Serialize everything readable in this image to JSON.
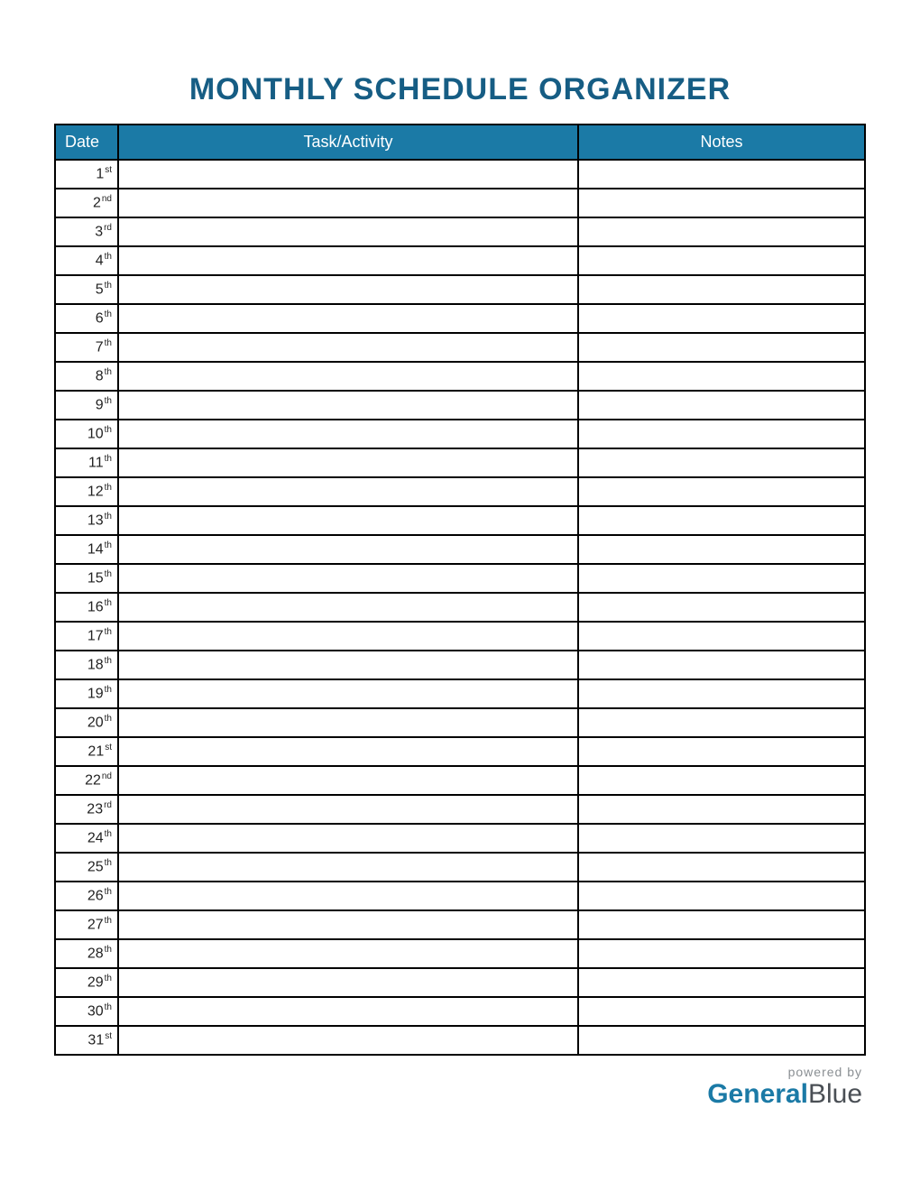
{
  "title": "MONTHLY SCHEDULE ORGANIZER",
  "headers": {
    "date": "Date",
    "task": "Task/Activity",
    "notes": "Notes"
  },
  "rows": [
    {
      "num": "1",
      "suffix": "st",
      "task": "",
      "notes": ""
    },
    {
      "num": "2",
      "suffix": "nd",
      "task": "",
      "notes": ""
    },
    {
      "num": "3",
      "suffix": "rd",
      "task": "",
      "notes": ""
    },
    {
      "num": "4",
      "suffix": "th",
      "task": "",
      "notes": ""
    },
    {
      "num": "5",
      "suffix": "th",
      "task": "",
      "notes": ""
    },
    {
      "num": "6",
      "suffix": "th",
      "task": "",
      "notes": ""
    },
    {
      "num": "7",
      "suffix": "th",
      "task": "",
      "notes": ""
    },
    {
      "num": "8",
      "suffix": "th",
      "task": "",
      "notes": ""
    },
    {
      "num": "9",
      "suffix": "th",
      "task": "",
      "notes": ""
    },
    {
      "num": "10",
      "suffix": "th",
      "task": "",
      "notes": ""
    },
    {
      "num": "11",
      "suffix": "th",
      "task": "",
      "notes": ""
    },
    {
      "num": "12",
      "suffix": "th",
      "task": "",
      "notes": ""
    },
    {
      "num": "13",
      "suffix": "th",
      "task": "",
      "notes": ""
    },
    {
      "num": "14",
      "suffix": "th",
      "task": "",
      "notes": ""
    },
    {
      "num": "15",
      "suffix": "th",
      "task": "",
      "notes": ""
    },
    {
      "num": "16",
      "suffix": "th",
      "task": "",
      "notes": ""
    },
    {
      "num": "17",
      "suffix": "th",
      "task": "",
      "notes": ""
    },
    {
      "num": "18",
      "suffix": "th",
      "task": "",
      "notes": ""
    },
    {
      "num": "19",
      "suffix": "th",
      "task": "",
      "notes": ""
    },
    {
      "num": "20",
      "suffix": "th",
      "task": "",
      "notes": ""
    },
    {
      "num": "21",
      "suffix": "st",
      "task": "",
      "notes": ""
    },
    {
      "num": "22",
      "suffix": "nd",
      "task": "",
      "notes": ""
    },
    {
      "num": "23",
      "suffix": "rd",
      "task": "",
      "notes": ""
    },
    {
      "num": "24",
      "suffix": "th",
      "task": "",
      "notes": ""
    },
    {
      "num": "25",
      "suffix": "th",
      "task": "",
      "notes": ""
    },
    {
      "num": "26",
      "suffix": "th",
      "task": "",
      "notes": ""
    },
    {
      "num": "27",
      "suffix": "th",
      "task": "",
      "notes": ""
    },
    {
      "num": "28",
      "suffix": "th",
      "task": "",
      "notes": ""
    },
    {
      "num": "29",
      "suffix": "th",
      "task": "",
      "notes": ""
    },
    {
      "num": "30",
      "suffix": "th",
      "task": "",
      "notes": ""
    },
    {
      "num": "31",
      "suffix": "st",
      "task": "",
      "notes": ""
    }
  ],
  "footer": {
    "powered_by": "powered by",
    "brand_first": "General",
    "brand_second": "Blue"
  }
}
